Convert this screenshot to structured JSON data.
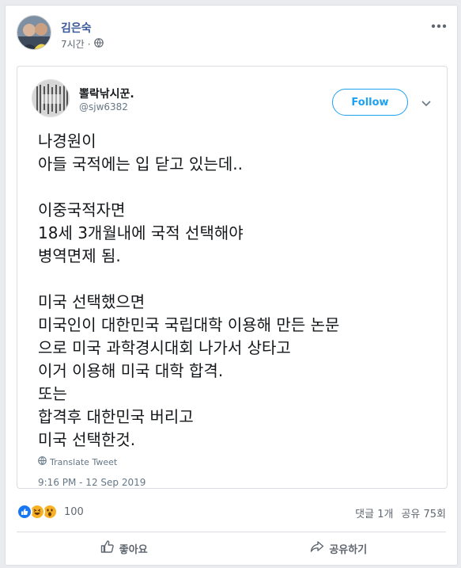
{
  "post": {
    "author": "김은숙",
    "time": "7시간",
    "privacy_icon": "globe-icon"
  },
  "tweet": {
    "name": "뽈락낚시꾼.",
    "handle": "@sjw6382",
    "follow_label": "Follow",
    "lines": [
      "나경원이",
      "아들 국적에는 입 닫고 있는데..",
      "",
      "이중국적자면",
      "18세 3개월내에 국적 선택해야",
      "병역면제 됨.",
      "",
      "미국 선택했으면",
      "미국인이 대한민국 국립대학 이용해 만든 논문",
      "으로 미국 과학경시대회 나가서 상타고",
      "이거 이용해 미국 대학 합격.",
      "또는",
      "합격후 대한민국 버리고",
      "미국 선택한것."
    ],
    "translate_label": "Translate Tweet",
    "timestamp": "9:16 PM - 12 Sep 2019"
  },
  "reactions": {
    "icons": [
      "like-icon",
      "haha-icon",
      "wow-icon"
    ],
    "count": "100",
    "comments": "댓글 1개",
    "shares": "공유 75회"
  },
  "actions": {
    "like_label": "좋아요",
    "share_label": "공유하기"
  },
  "colors": {
    "link": "#385898",
    "twitter_blue": "#1da1f2",
    "like_blue": "#1877f2"
  }
}
